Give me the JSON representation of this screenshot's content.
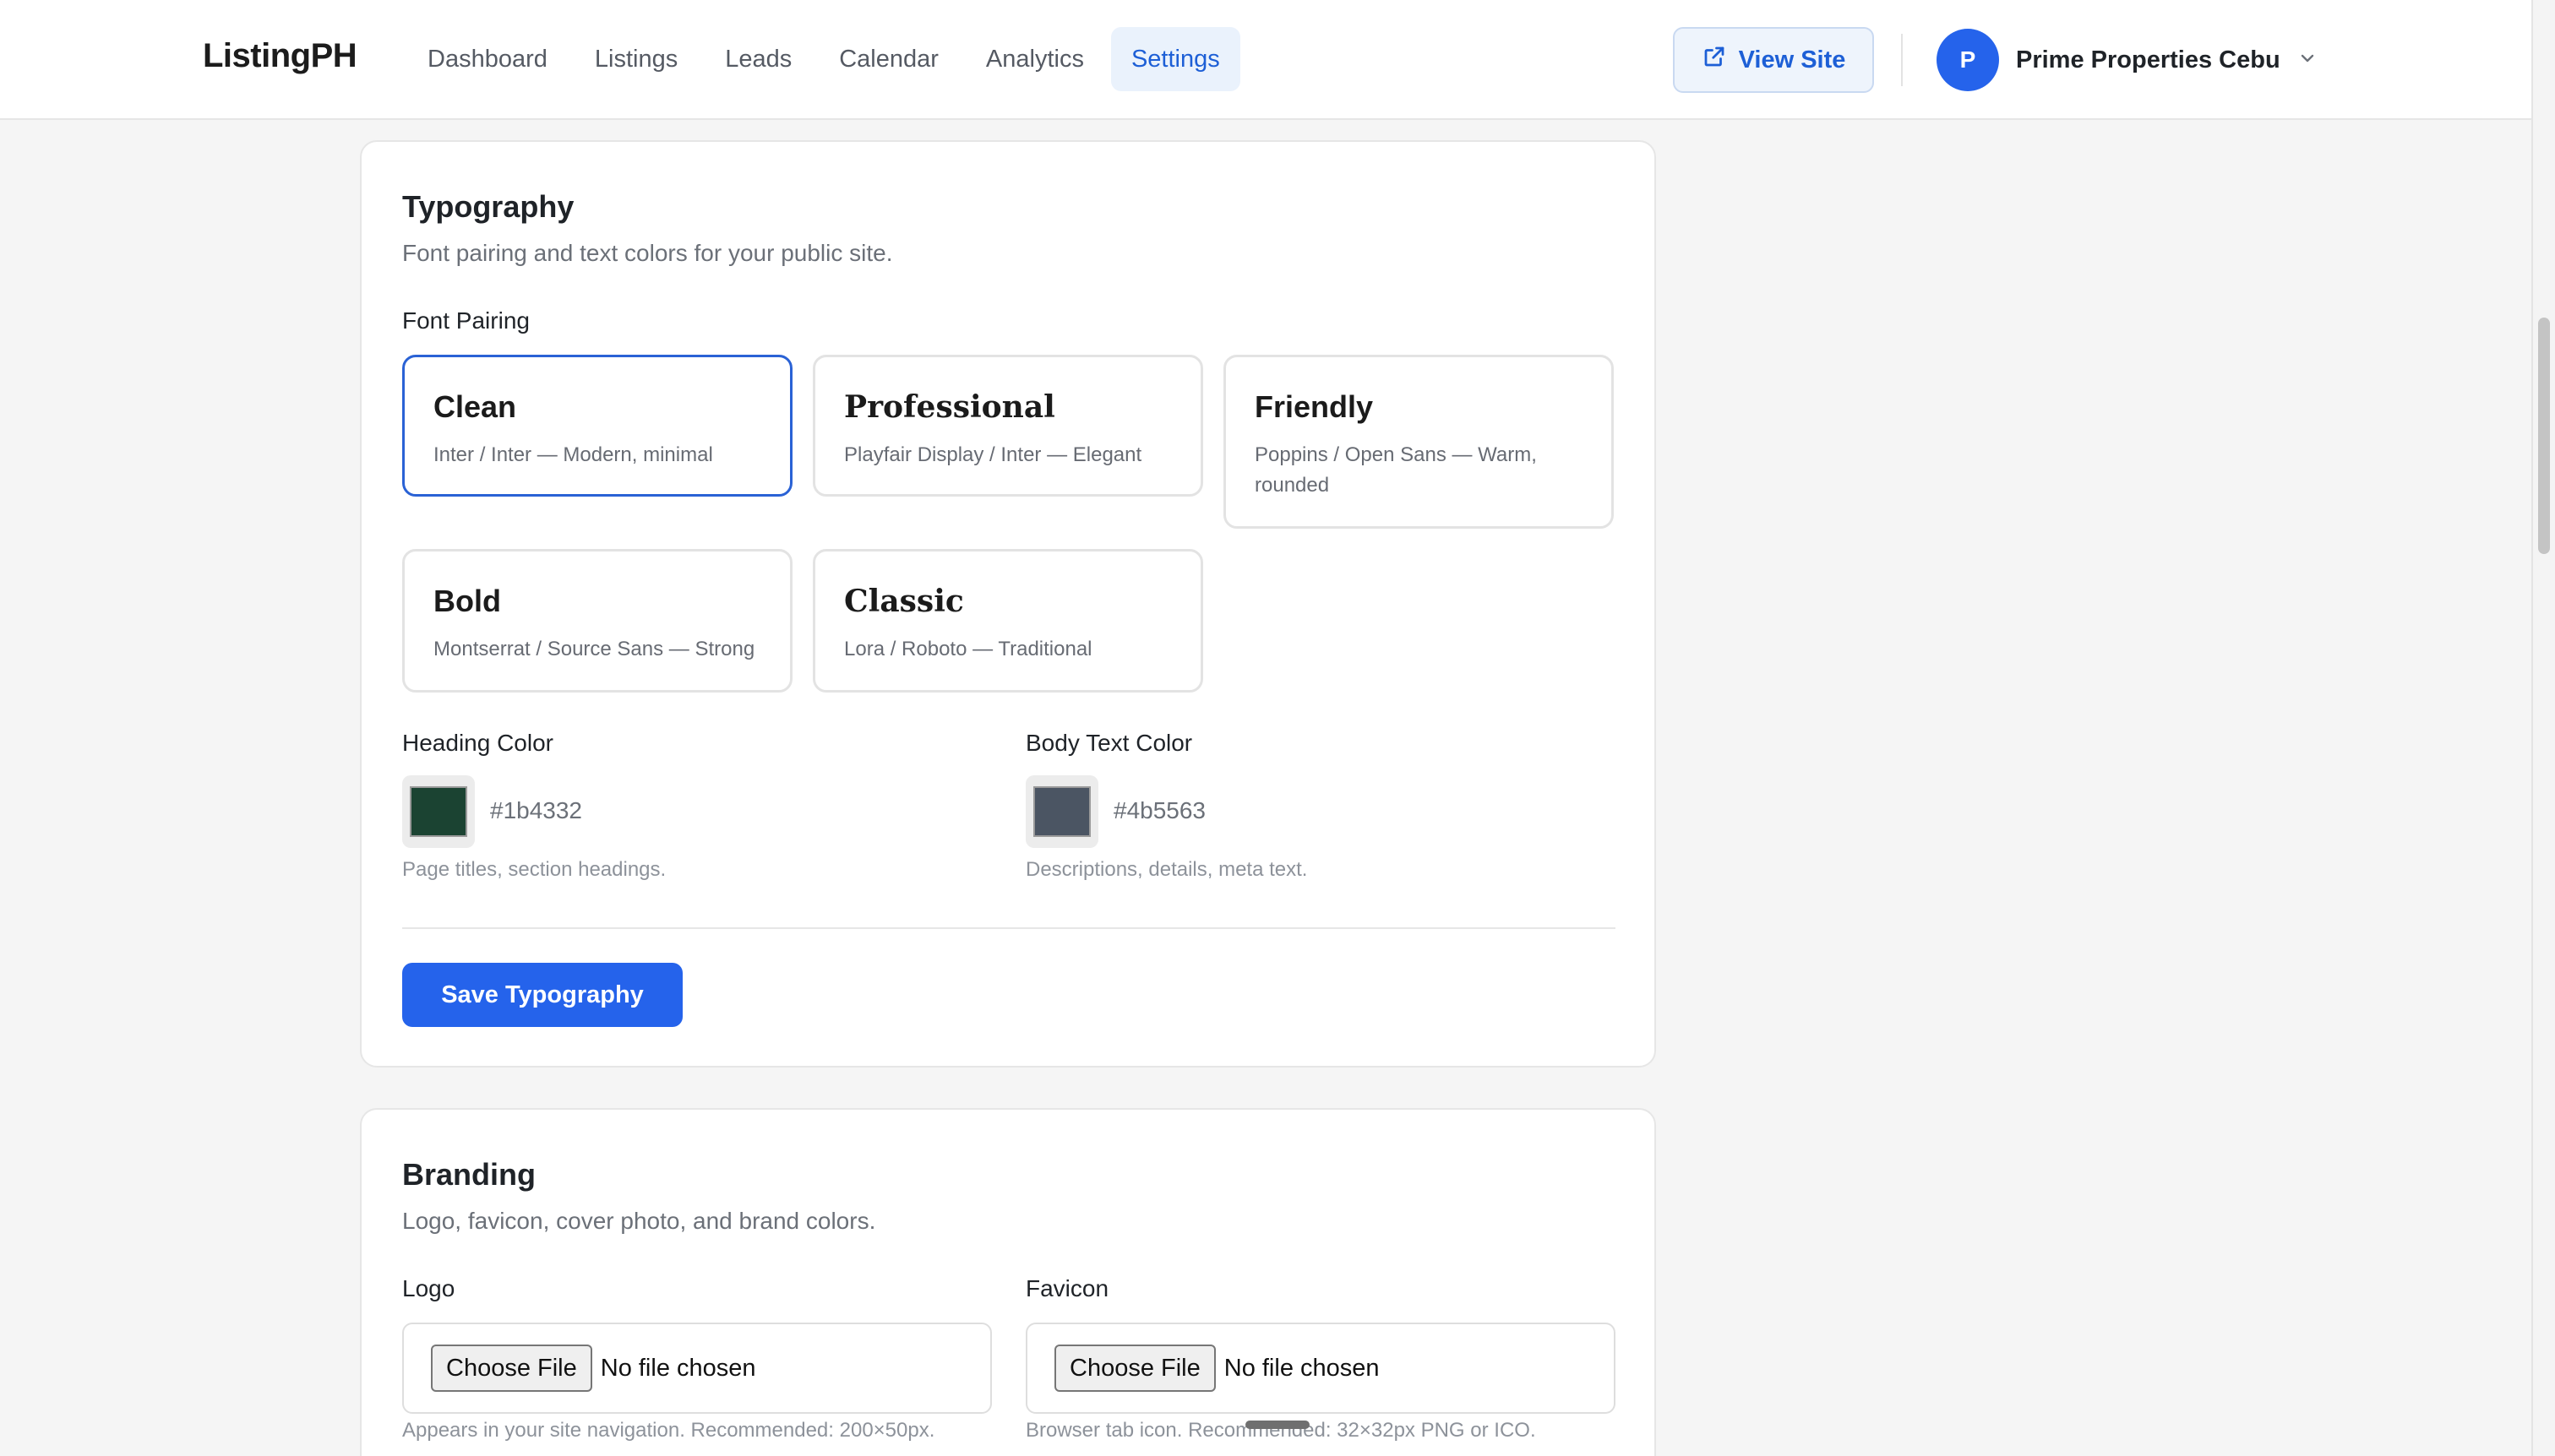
{
  "app": {
    "brand": "ListingPH"
  },
  "nav": {
    "items": [
      {
        "label": "Dashboard"
      },
      {
        "label": "Listings"
      },
      {
        "label": "Leads"
      },
      {
        "label": "Calendar"
      },
      {
        "label": "Analytics"
      },
      {
        "label": "Settings",
        "active": true
      }
    ]
  },
  "header": {
    "view_site_label": "View Site",
    "view_site_icon": "external-link-icon",
    "account": {
      "initial": "P",
      "name": "Prime Properties Cebu",
      "menu_icon": "chevron-down-icon"
    }
  },
  "typography": {
    "title": "Typography",
    "subtitle": "Font pairing and text colors for your public site.",
    "font_pairing_label": "Font Pairing",
    "options": [
      {
        "name": "Clean",
        "desc": "Inter / Inter — Modern, minimal",
        "selected": true
      },
      {
        "name": "Professional",
        "desc": "Playfair Display / Inter — Elegant",
        "selected": false
      },
      {
        "name": "Friendly",
        "desc": "Poppins / Open Sans — Warm, rounded",
        "selected": false
      },
      {
        "name": "Bold",
        "desc": "Montserrat / Source Sans — Strong",
        "selected": false
      },
      {
        "name": "Classic",
        "desc": "Lora / Roboto — Traditional",
        "selected": false
      }
    ],
    "heading_color": {
      "label": "Heading Color",
      "value": "#1b4332",
      "hint": "Page titles, section headings."
    },
    "body_color": {
      "label": "Body Text Color",
      "value": "#4b5563",
      "hint": "Descriptions, details, meta text."
    },
    "save_label": "Save Typography"
  },
  "branding": {
    "title": "Branding",
    "subtitle": "Logo, favicon, cover photo, and brand colors.",
    "logo": {
      "label": "Logo",
      "button": "Choose File",
      "status": "No file chosen",
      "hint": "Appears in your site navigation. Recommended: 200×50px."
    },
    "favicon": {
      "label": "Favicon",
      "button": "Choose File",
      "status": "No file chosen",
      "hint": "Browser tab icon. Recommended: 32×32px PNG or ICO."
    }
  },
  "colors": {
    "accent": "#2563eb",
    "selected_border": "#2a62d5",
    "active_nav_bg": "#eaf2fc"
  }
}
